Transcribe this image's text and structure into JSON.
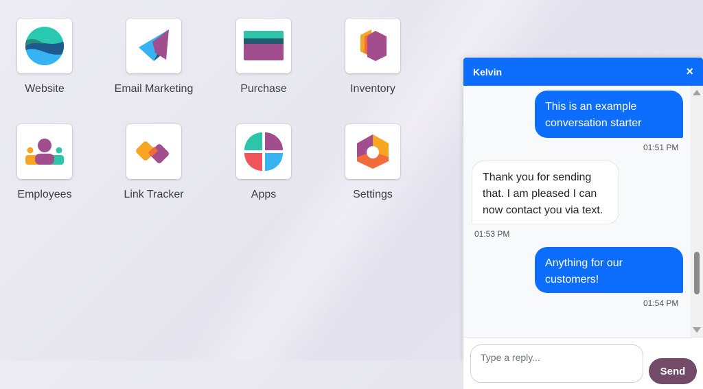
{
  "apps": [
    {
      "label": "Website",
      "icon": "website-icon"
    },
    {
      "label": "Email Marketing",
      "icon": "email-marketing-icon"
    },
    {
      "label": "Purchase",
      "icon": "purchase-icon"
    },
    {
      "label": "Inventory",
      "icon": "inventory-icon"
    },
    {
      "label": "Employees",
      "icon": "employees-icon"
    },
    {
      "label": "Link Tracker",
      "icon": "link-tracker-icon"
    },
    {
      "label": "Apps",
      "icon": "apps-icon"
    },
    {
      "label": "Settings",
      "icon": "settings-icon"
    }
  ],
  "chat": {
    "title": "Kelvin",
    "close_icon": "×",
    "messages": [
      {
        "direction": "out",
        "text": "This is an example conversation starter",
        "time": "01:51 PM"
      },
      {
        "direction": "in",
        "text": "Thank you for sending that. I am pleased I can now contact you via text.",
        "time": "01:53 PM"
      },
      {
        "direction": "out",
        "text": "Anything for our customers!",
        "time": "01:54 PM"
      }
    ],
    "reply_placeholder": "Type a reply...",
    "send_label": "Send"
  },
  "colors": {
    "chat_header": "#0d6efd",
    "outgoing_bubble": "#0d6efd",
    "send_button": "#714b67"
  }
}
